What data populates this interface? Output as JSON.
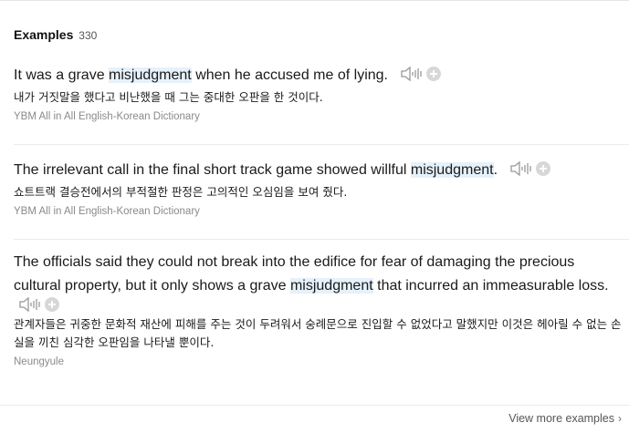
{
  "section": {
    "title": "Examples",
    "count": "330"
  },
  "examples": [
    {
      "en_pre": "It was a grave ",
      "keyword": "misjudgment",
      "en_post": " when he accused me of lying.",
      "ko": "내가 거짓말을 했다고 비난했을 때 그는 중대한 오판을 한 것이다.",
      "source": "YBM All in All English-Korean Dictionary"
    },
    {
      "en_pre": "The irrelevant call in the final short track game showed willful ",
      "keyword": "misjudgment",
      "en_post": ".",
      "ko": "쇼트트랙 결승전에서의 부적절한 판정은 고의적인 오심임을 보여 줬다.",
      "source": "YBM All in All English-Korean Dictionary"
    },
    {
      "en_pre": "The officials said they could not break into the edifice for fear of damaging the precious cultural property, but it only shows a grave ",
      "keyword": "misjudgment",
      "en_post": " that incurred an immeasurable loss.",
      "ko": "관계자들은 귀중한 문화적 재산에 피해를 주는 것이 두려워서 숭례문으로 진입할 수 없었다고 말했지만 이것은 헤아릴 수 없는 손실을 끼친 심각한 오판임을 나타낼 뿐이다.",
      "source": "Neungyule"
    }
  ],
  "icons": {
    "audio": "speaker-icon",
    "add": "plus-circle-icon",
    "more": "chevron-right-icon"
  },
  "footer": {
    "view_more": "View more examples"
  },
  "colors": {
    "highlight": "#e5f1fb",
    "source_text": "#8a8a8a",
    "plus_bg": "#d7d7d7"
  }
}
